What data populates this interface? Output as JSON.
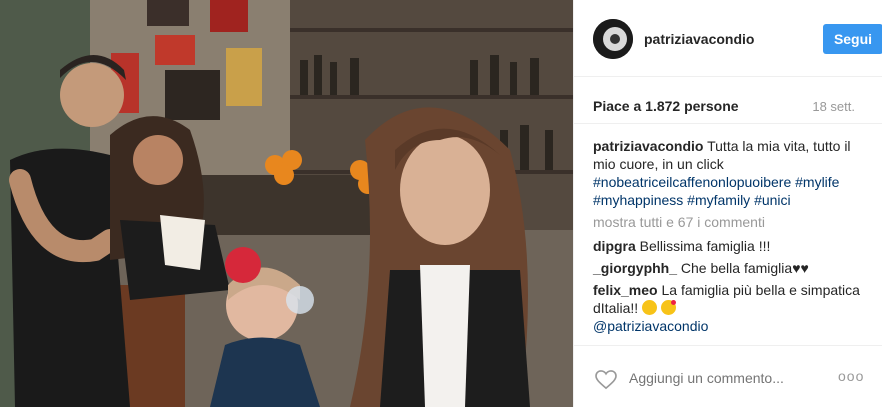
{
  "header": {
    "username": "patriziavacondio",
    "follow_label": "Segui"
  },
  "stats": {
    "likes": "Piace a 1.872 persone",
    "time": "18 sett."
  },
  "caption": {
    "username": "patriziavacondio",
    "text": "Tutta la mia vita, tutto il mio cuore, in un click",
    "hashtags": [
      "#nobeatriceilcaffenonlopuoibere",
      "#mylife",
      "#myhappiness",
      "#myfamily",
      "#unici"
    ]
  },
  "show_all_label": "mostra tutti e 67 i commenti",
  "comments": [
    {
      "user": "dipgra",
      "text": "Bellissima famiglia !!!"
    },
    {
      "user": "_giorgyphh_",
      "text": "Che bella famiglia♥♥"
    },
    {
      "user": "felix_meo",
      "text": "La famiglia più bella e simpatica dItalia!!"
    }
  ],
  "mention": "@patriziavacondio",
  "footer": {
    "comment_placeholder": "Aggiungi un commento...",
    "more_label": "ooo"
  },
  "icons": {
    "like": "heart-outline-icon",
    "more": "more-options-icon",
    "emoji": [
      "grinning-face-emoji",
      "wink-kiss-emoji"
    ]
  },
  "colors": {
    "follow_button": "#3897f0",
    "hashtag": "#003569",
    "muted": "#999999"
  }
}
